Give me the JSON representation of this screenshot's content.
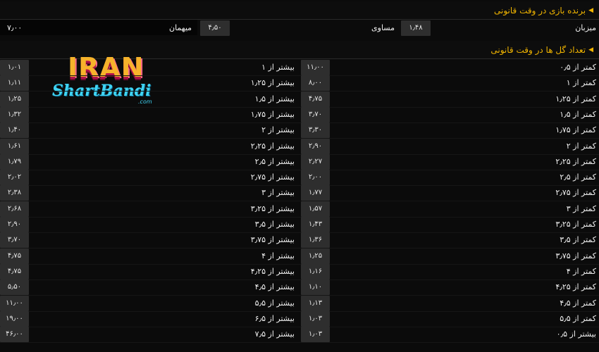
{
  "match_winner": {
    "title": "برنده بازی در وقت قانونی",
    "home_label": "میزبان",
    "home_odd": "۱٫۴۸",
    "draw_label": "مساوی",
    "draw_odd": "۴٫۵۰",
    "away_label": "میهمان",
    "away_odd": "۷٫۰۰"
  },
  "total_goals": {
    "title": "تعداد گل ها در وقت قانونی",
    "rows": [
      {
        "under_label": "کمتر از ۰٫۵",
        "under_odd": "۱۱٫۰۰",
        "over_label": "بیشتر از ۱",
        "over_odd": "۱٫۰۱"
      },
      {
        "under_label": "کمتر از ۱",
        "under_odd": "۸٫۰۰",
        "over_label": "بیشتر از ۱٫۲۵",
        "over_odd": "۱٫۱۱"
      },
      {
        "under_label": "کمتر از ۱٫۲۵",
        "under_odd": "۴٫۷۵",
        "over_label": "بیشتر از ۱٫۵",
        "over_odd": "۱٫۲۵"
      },
      {
        "under_label": "کمتر از ۱٫۵",
        "under_odd": "۳٫۷۰",
        "over_label": "بیشتر از ۱٫۷۵",
        "over_odd": "۱٫۳۲"
      },
      {
        "under_label": "کمتر از ۱٫۷۵",
        "under_odd": "۳٫۳۰",
        "over_label": "بیشتر از ۲",
        "over_odd": "۱٫۴۰"
      },
      {
        "under_label": "کمتر از ۲",
        "under_odd": "۲٫۹۰",
        "over_label": "بیشتر از ۲٫۲۵",
        "over_odd": "۱٫۶۱"
      },
      {
        "under_label": "کمتر از ۲٫۲۵",
        "under_odd": "۲٫۲۷",
        "over_label": "بیشتر از ۲٫۵",
        "over_odd": "۱٫۷۹"
      },
      {
        "under_label": "کمتر از ۲٫۵",
        "under_odd": "۲٫۰۰",
        "over_label": "بیشتر از ۲٫۷۵",
        "over_odd": "۲٫۰۲"
      },
      {
        "under_label": "کمتر از ۲٫۷۵",
        "under_odd": "۱٫۷۷",
        "over_label": "بیشتر از ۳",
        "over_odd": "۲٫۳۸"
      },
      {
        "under_label": "کمتر از ۳",
        "under_odd": "۱٫۵۷",
        "over_label": "بیشتر از ۳٫۲۵",
        "over_odd": "۲٫۶۸"
      },
      {
        "under_label": "کمتر از ۳٫۲۵",
        "under_odd": "۱٫۴۳",
        "over_label": "بیشتر از ۳٫۵",
        "over_odd": "۲٫۹۰"
      },
      {
        "under_label": "کمتر از ۳٫۵",
        "under_odd": "۱٫۳۶",
        "over_label": "بیشتر از ۳٫۷۵",
        "over_odd": "۳٫۷۰"
      },
      {
        "under_label": "کمتر از ۳٫۷۵",
        "under_odd": "۱٫۲۵",
        "over_label": "بیشتر از ۴",
        "over_odd": "۴٫۷۵"
      },
      {
        "under_label": "کمتر از ۴",
        "under_odd": "۱٫۱۶",
        "over_label": "بیشتر از ۴٫۲۵",
        "over_odd": "۴٫۷۵"
      },
      {
        "under_label": "کمتر از ۴٫۲۵",
        "under_odd": "۱٫۱۰",
        "over_label": "بیشتر از ۴٫۵",
        "over_odd": "۵٫۵۰"
      },
      {
        "under_label": "کمتر از ۴٫۵",
        "under_odd": "۱٫۱۳",
        "over_label": "بیشتر از ۵٫۵",
        "over_odd": "۱۱٫۰۰"
      },
      {
        "under_label": "کمتر از ۵٫۵",
        "under_odd": "۱٫۰۳",
        "over_label": "بیشتر از ۶٫۵",
        "over_odd": "۱۹٫۰۰"
      },
      {
        "under_label": "بیشتر از ۰٫۵",
        "under_odd": "۱٫۰۳",
        "over_label": "بیشتر از ۷٫۵",
        "over_odd": "۴۶٫۰۰"
      }
    ]
  },
  "logo": {
    "line1": "IRAN",
    "line2": "ShartBandi",
    "line3": ".com"
  },
  "colors": {
    "accent": "#f0b400",
    "background": "#0b0b0b",
    "odd_box": "#2e2e2e"
  }
}
